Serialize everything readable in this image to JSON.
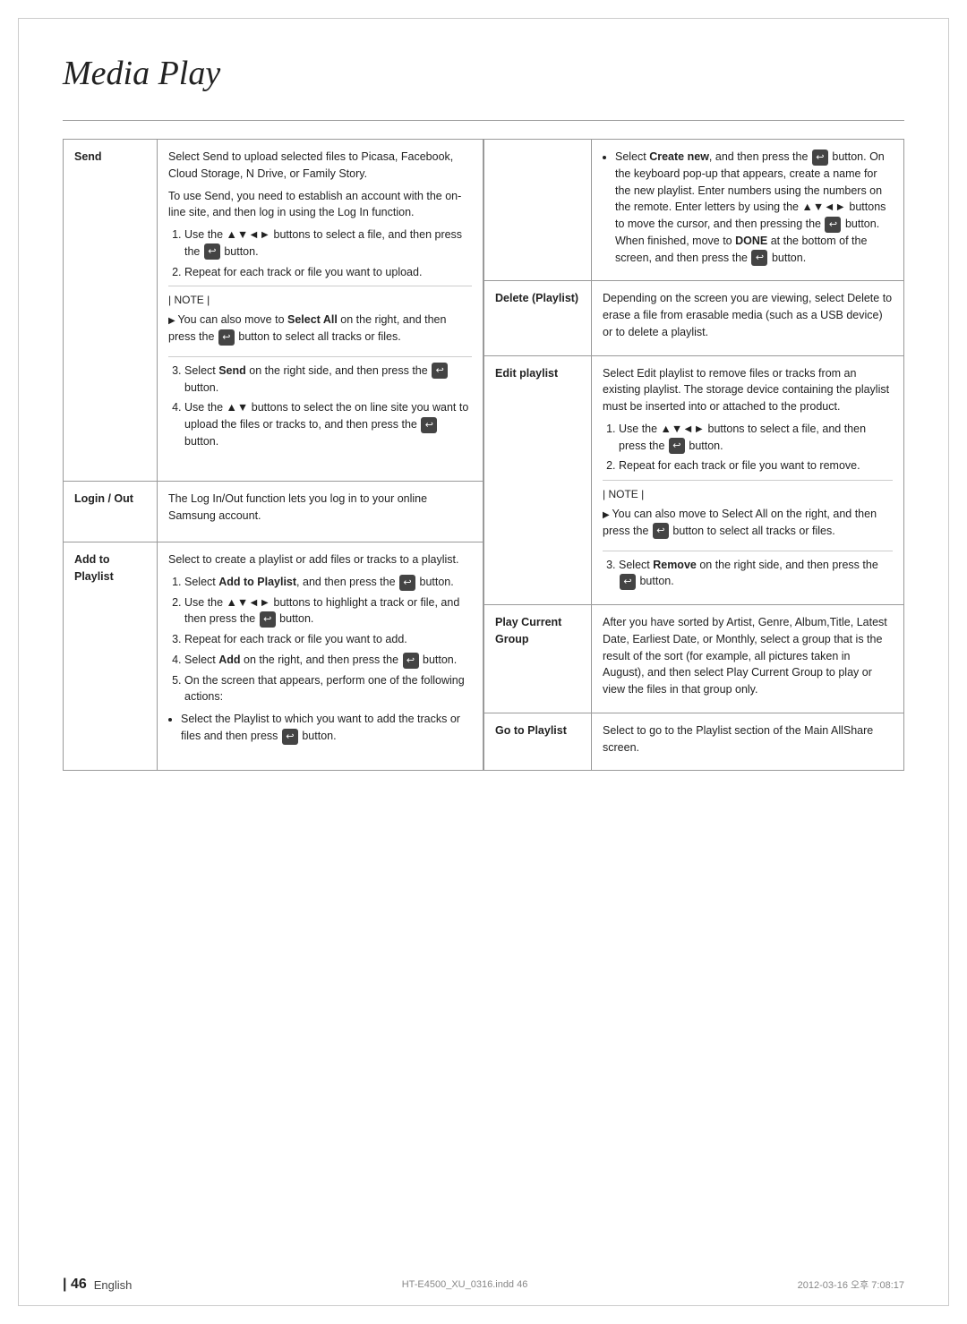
{
  "page": {
    "title": "Media Play",
    "page_number": "46",
    "language": "English",
    "filename": "HT-E4500_XU_0316.indd  46",
    "date": "2012-03-16  오후 7:08:17"
  },
  "left_table": {
    "rows": [
      {
        "label": "Send",
        "content_paragraphs": [
          "Select Send to upload selected files to Picasa, Facebook, Cloud Storage, N Drive, or Family Story.",
          "To use Send, you need to establish an account with the on-line site, and then log in using the Log In function."
        ],
        "steps": [
          "Use the ▲▼◄► buttons to select a file, and then press the  button.",
          "Repeat for each track or file you want to upload."
        ],
        "note": "You can also move to Select All on the right, and then press the  button to select all tracks or files.",
        "extra_steps": [
          "Select Send on the right side, and then press the  button.",
          "Use the ▲▼ buttons to select the on line site you want to upload the files or tracks to, and then press the  button."
        ]
      },
      {
        "label": "Login / Out",
        "content": "The Log In/Out function lets you log in to your online Samsung account."
      },
      {
        "label": "Add to Playlist",
        "content_paragraphs": [
          "Select to create a playlist or add files or tracks to a playlist."
        ],
        "steps": [
          "Select Add to Playlist, and then press the  button.",
          "Use the ▲▼◄► buttons to highlight a track or file, and then press the  button.",
          "Repeat for each track or file you want to add.",
          "Select Add on the right, and then press the  button.",
          "On the screen that appears, perform one of the following actions:"
        ],
        "bullet": "Select the Playlist to which you want to add the tracks or files and then press  button."
      }
    ]
  },
  "right_table": {
    "rows": [
      {
        "label": "",
        "content_bullets": [
          "Select Create new, and then press the  button. On the keyboard pop-up that appears, create a name for the new playlist. Enter numbers using the numbers on the remote. Enter letters by using the ▲▼◄► buttons to move the cursor, and then pressing the  button. When finished, move to DONE at the bottom of the screen, and then press the  button."
        ]
      },
      {
        "label": "Delete (Playlist)",
        "content": "Depending on the screen you are viewing, select Delete to erase a file from erasable media (such as a USB device) or to delete a playlist."
      },
      {
        "label": "Edit playlist",
        "content_paragraphs": [
          "Select Edit playlist to remove files or tracks from an existing playlist. The storage device containing the playlist must be inserted into or attached to the product."
        ],
        "steps": [
          "Use the ▲▼◄► buttons to select a file, and then press the  button.",
          "Repeat for each track or file you want to remove."
        ],
        "note": "You can also move to Select All on the right, and then press the  button to select all tracks or files.",
        "extra_steps": [
          "Select Remove on the right side, and then press the  button."
        ]
      },
      {
        "label": "Play Current Group",
        "content": "After you have sorted by Artist, Genre, Album,Title, Latest Date, Earliest Date, or Monthly, select a group that is the result of the sort (for example, all pictures taken in August), and then select Play Current Group to play or view the files in that group only."
      },
      {
        "label": "Go to Playlist",
        "content": "Select to go to the Playlist section of the Main AllShare screen."
      }
    ]
  }
}
